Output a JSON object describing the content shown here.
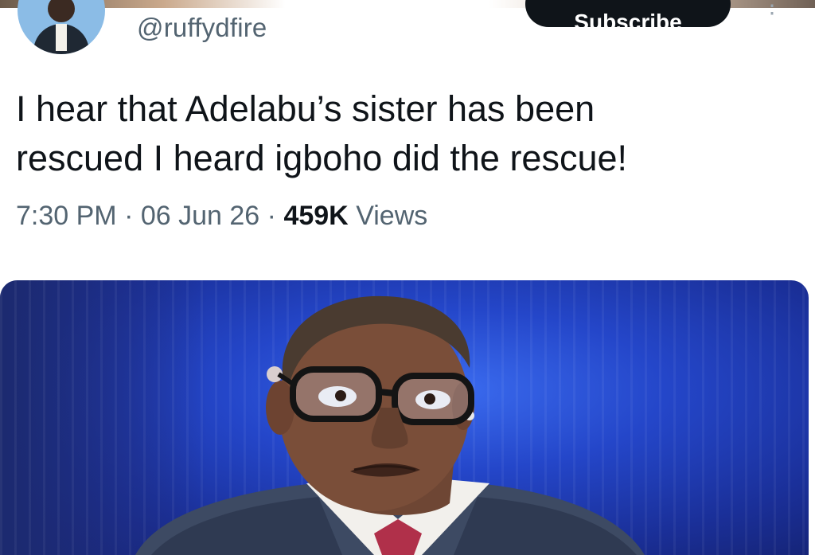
{
  "tweet": {
    "handle": "@ruffydfire",
    "subscribe_label": "Subscribe",
    "more_label": "⋮",
    "text_line1": "I hear that Adelabu’s sister has been",
    "text_line2": "rescued I heard igboho did the rescue!",
    "time": "7:30 PM",
    "date": "06 Jun 26",
    "views_count": "459K",
    "views_label": "Views",
    "separator": "·"
  },
  "colors": {
    "text_primary": "#0f1419",
    "text_secondary": "#536471",
    "button_bg": "#0f1419",
    "media_bg": "#2446c9"
  },
  "icons": {
    "avatar": "profile-avatar",
    "more": "more-options-icon"
  }
}
